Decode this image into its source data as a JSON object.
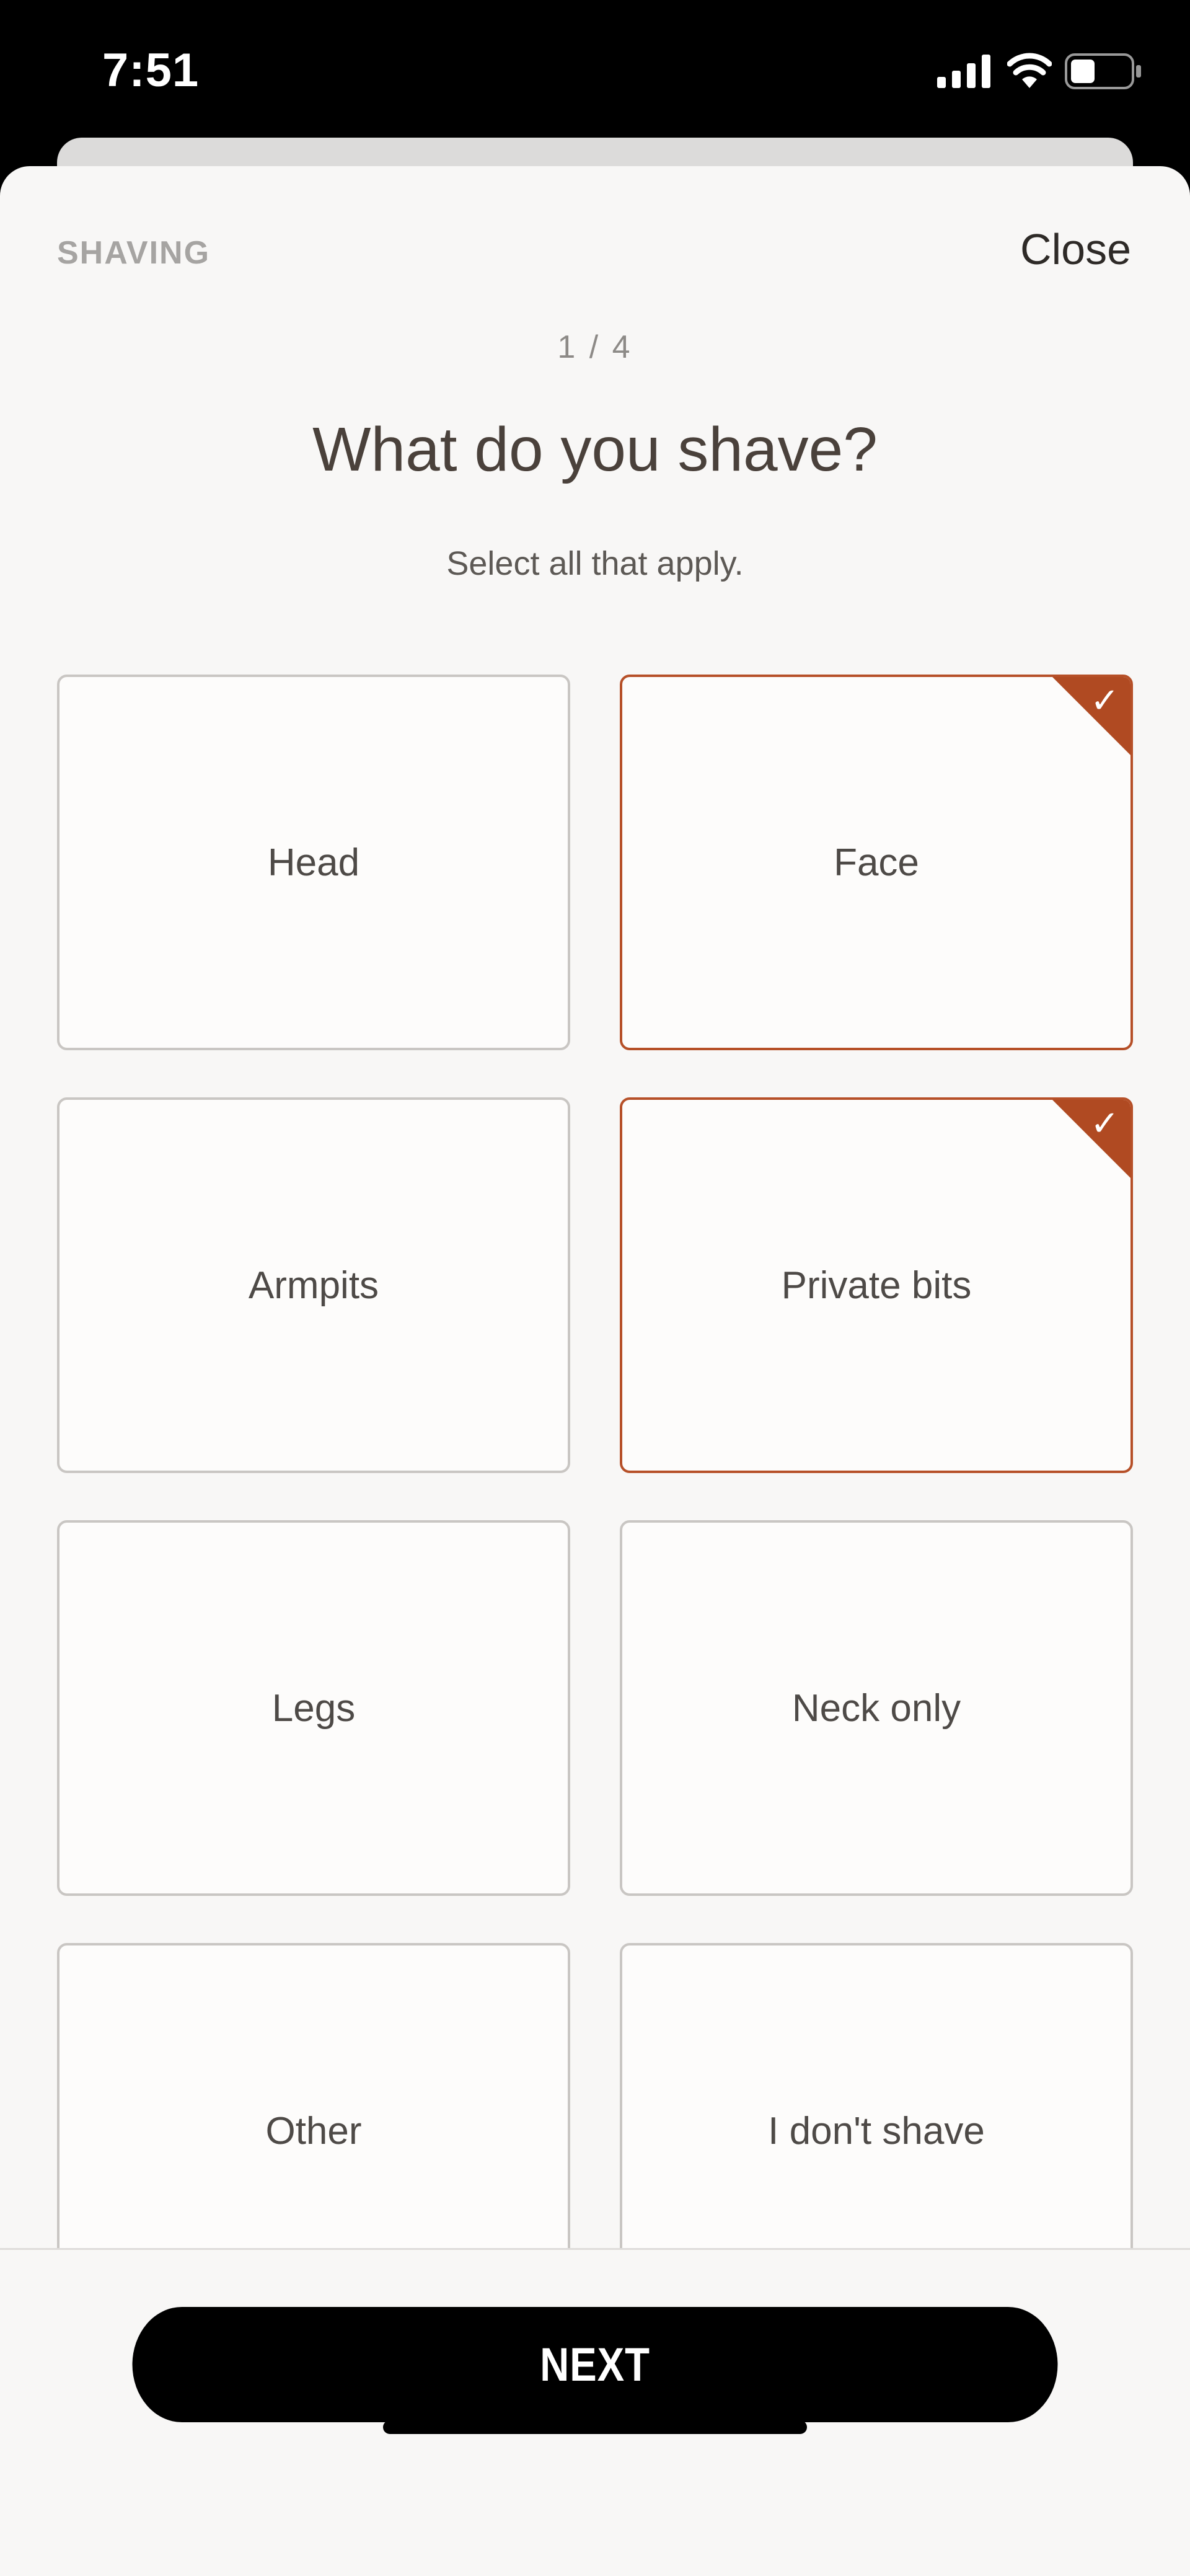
{
  "status_bar": {
    "time": "7:51",
    "icons": [
      "signal-icon",
      "wifi-icon",
      "battery-icon"
    ]
  },
  "header": {
    "section_label": "SHAVING",
    "close_label": "Close"
  },
  "question": {
    "step": "1 / 4",
    "title": "What do you shave?",
    "subtitle": "Select all that apply."
  },
  "options": [
    {
      "label": "Head",
      "selected": false
    },
    {
      "label": "Face",
      "selected": true
    },
    {
      "label": "Armpits",
      "selected": false
    },
    {
      "label": "Private bits",
      "selected": true
    },
    {
      "label": "Legs",
      "selected": false
    },
    {
      "label": "Neck only",
      "selected": false
    },
    {
      "label": "Other",
      "selected": false
    },
    {
      "label": "I don't shave",
      "selected": false
    }
  ],
  "footer": {
    "next_label": "NEXT"
  },
  "colors": {
    "accent": "#b04a22",
    "sheet_background": "#f8f7f6",
    "title_text": "#4a413b",
    "button_background": "#000000"
  }
}
